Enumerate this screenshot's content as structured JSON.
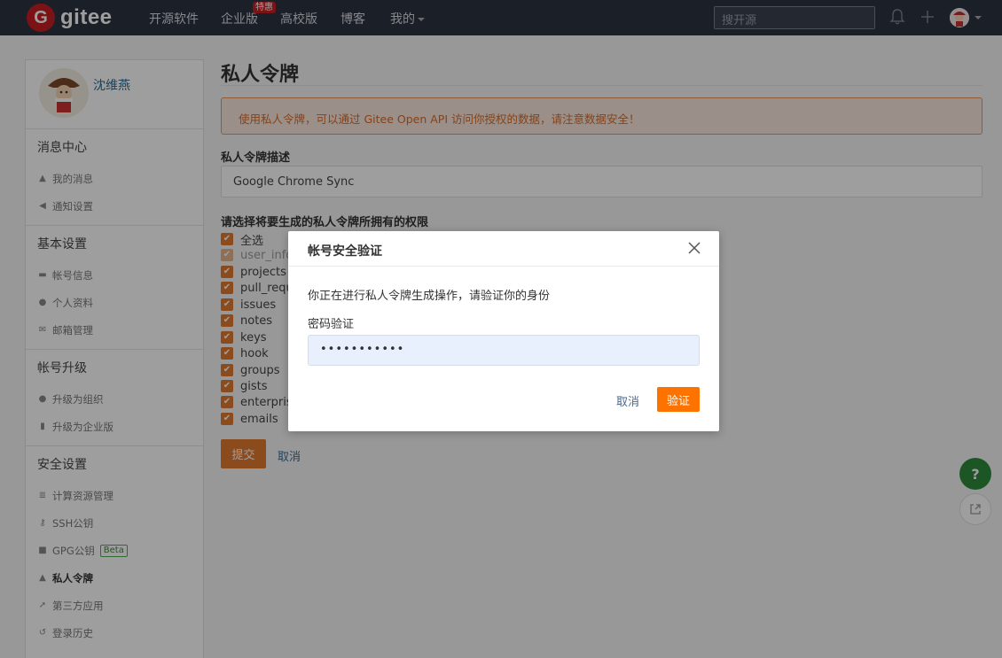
{
  "nav": {
    "logo_letter": "G",
    "logo_text": "gitee",
    "items": [
      "开源软件",
      "企业版",
      "高校版",
      "博客",
      "我的"
    ],
    "enterprise_badge": "特惠",
    "search_placeholder": "搜开源",
    "icons": [
      "bell-icon",
      "plus-icon",
      "avatar"
    ]
  },
  "sidebar": {
    "username": "沈维燕",
    "sections": [
      {
        "title": "消息中心",
        "items": [
          {
            "icon": "bell-icon",
            "label": "我的消息"
          },
          {
            "icon": "speaker-icon",
            "label": "通知设置"
          }
        ]
      },
      {
        "title": "基本设置",
        "items": [
          {
            "icon": "id-card-icon",
            "label": "帐号信息"
          },
          {
            "icon": "user-icon",
            "label": "个人资料"
          },
          {
            "icon": "mail-icon",
            "label": "邮箱管理"
          }
        ]
      },
      {
        "title": "帐号升级",
        "items": [
          {
            "icon": "group-icon",
            "label": "升级为组织"
          },
          {
            "icon": "building-icon",
            "label": "升级为企业版"
          }
        ]
      },
      {
        "title": "安全设置",
        "items": [
          {
            "icon": "server-icon",
            "label": "计算资源管理"
          },
          {
            "icon": "key-icon",
            "label": "SSH公钥"
          },
          {
            "icon": "lock-icon",
            "label": "GPG公钥",
            "badge": "Beta"
          },
          {
            "icon": "token-icon",
            "label": "私人令牌",
            "active": true
          },
          {
            "icon": "rocket-icon",
            "label": "第三方应用"
          },
          {
            "icon": "history-icon",
            "label": "登录历史"
          }
        ]
      }
    ]
  },
  "main": {
    "title": "私人令牌",
    "alert": "使用私人令牌，可以通过 Gitee Open API 访问你授权的数据，请注意数据安全！",
    "desc_label": "私人令牌描述",
    "desc_value": "Google Chrome Sync",
    "perm_label": "请选择将要生成的私人令牌所拥有的权限",
    "permissions": [
      {
        "label": "全选",
        "checked": true,
        "disabled": false
      },
      {
        "label": "user_info",
        "checked": true,
        "disabled": true
      },
      {
        "label": "projects",
        "checked": true,
        "disabled": false
      },
      {
        "label": "pull_requests",
        "checked": true,
        "disabled": false
      },
      {
        "label": "issues",
        "checked": true,
        "disabled": false
      },
      {
        "label": "notes",
        "checked": true,
        "disabled": false
      },
      {
        "label": "keys",
        "checked": true,
        "disabled": false
      },
      {
        "label": "hook",
        "checked": true,
        "disabled": false
      },
      {
        "label": "groups",
        "checked": true,
        "disabled": false
      },
      {
        "label": "gists",
        "checked": true,
        "disabled": false
      },
      {
        "label": "enterprises",
        "checked": true,
        "disabled": false
      },
      {
        "label": "emails",
        "checked": true,
        "disabled": false
      }
    ],
    "submit_label": "提交",
    "cancel_label": "取消"
  },
  "floating": {
    "help_label": "?"
  },
  "modal": {
    "title": "帐号安全验证",
    "message": "你正在进行私人令牌生成操作，请验证你的身份",
    "password_label": "密码验证",
    "password_value": "•••••••••••",
    "cancel_label": "取消",
    "confirm_label": "验证"
  },
  "colors": {
    "nav_bg": "#2b3242",
    "accent": "#e07a2f",
    "modal_confirm": "#fe7300",
    "help_button": "#2e8b3d",
    "brand_red": "#c71d23"
  }
}
